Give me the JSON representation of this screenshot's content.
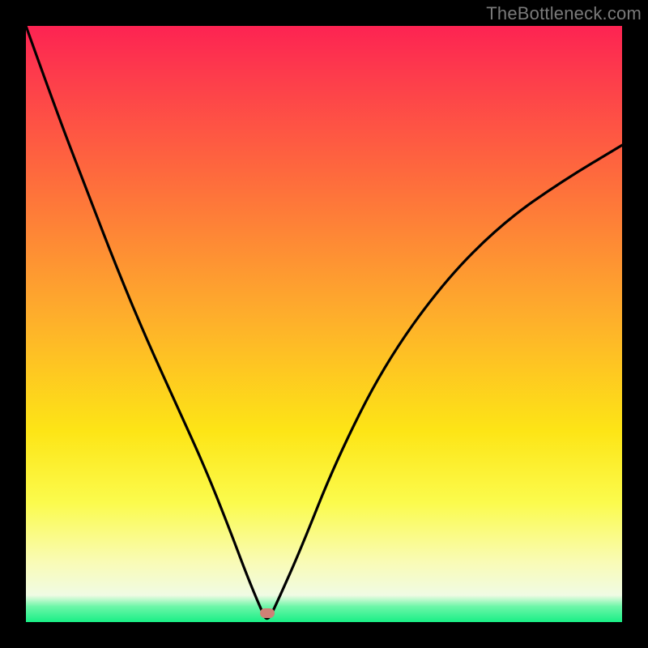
{
  "watermark": {
    "text": "TheBottleneck.com"
  },
  "marker": {
    "x_frac": 0.405,
    "y_frac": 0.985
  },
  "chart_data": {
    "type": "line",
    "title": "",
    "xlabel": "",
    "ylabel": "",
    "xlim": [
      0,
      1
    ],
    "ylim": [
      0,
      1
    ],
    "series": [
      {
        "name": "bottleneck-curve",
        "x": [
          0.0,
          0.05,
          0.1,
          0.15,
          0.2,
          0.25,
          0.3,
          0.34,
          0.37,
          0.395,
          0.405,
          0.42,
          0.46,
          0.52,
          0.6,
          0.7,
          0.8,
          0.9,
          1.0
        ],
        "y": [
          1.0,
          0.86,
          0.73,
          0.6,
          0.48,
          0.37,
          0.26,
          0.16,
          0.08,
          0.02,
          0.0,
          0.03,
          0.12,
          0.27,
          0.43,
          0.57,
          0.67,
          0.74,
          0.8
        ]
      }
    ],
    "marker_point": {
      "x": 0.405,
      "y": 0.0,
      "color": "#cf8176"
    },
    "background_gradient": {
      "direction": "vertical",
      "stops": [
        {
          "pos": 0.0,
          "color": "#fd2352"
        },
        {
          "pos": 0.25,
          "color": "#fe6a3d"
        },
        {
          "pos": 0.48,
          "color": "#feac2c"
        },
        {
          "pos": 0.68,
          "color": "#fde516"
        },
        {
          "pos": 0.9,
          "color": "#f9fbb6"
        },
        {
          "pos": 0.97,
          "color": "#6cf6a8"
        },
        {
          "pos": 1.0,
          "color": "#19ef86"
        }
      ]
    }
  }
}
